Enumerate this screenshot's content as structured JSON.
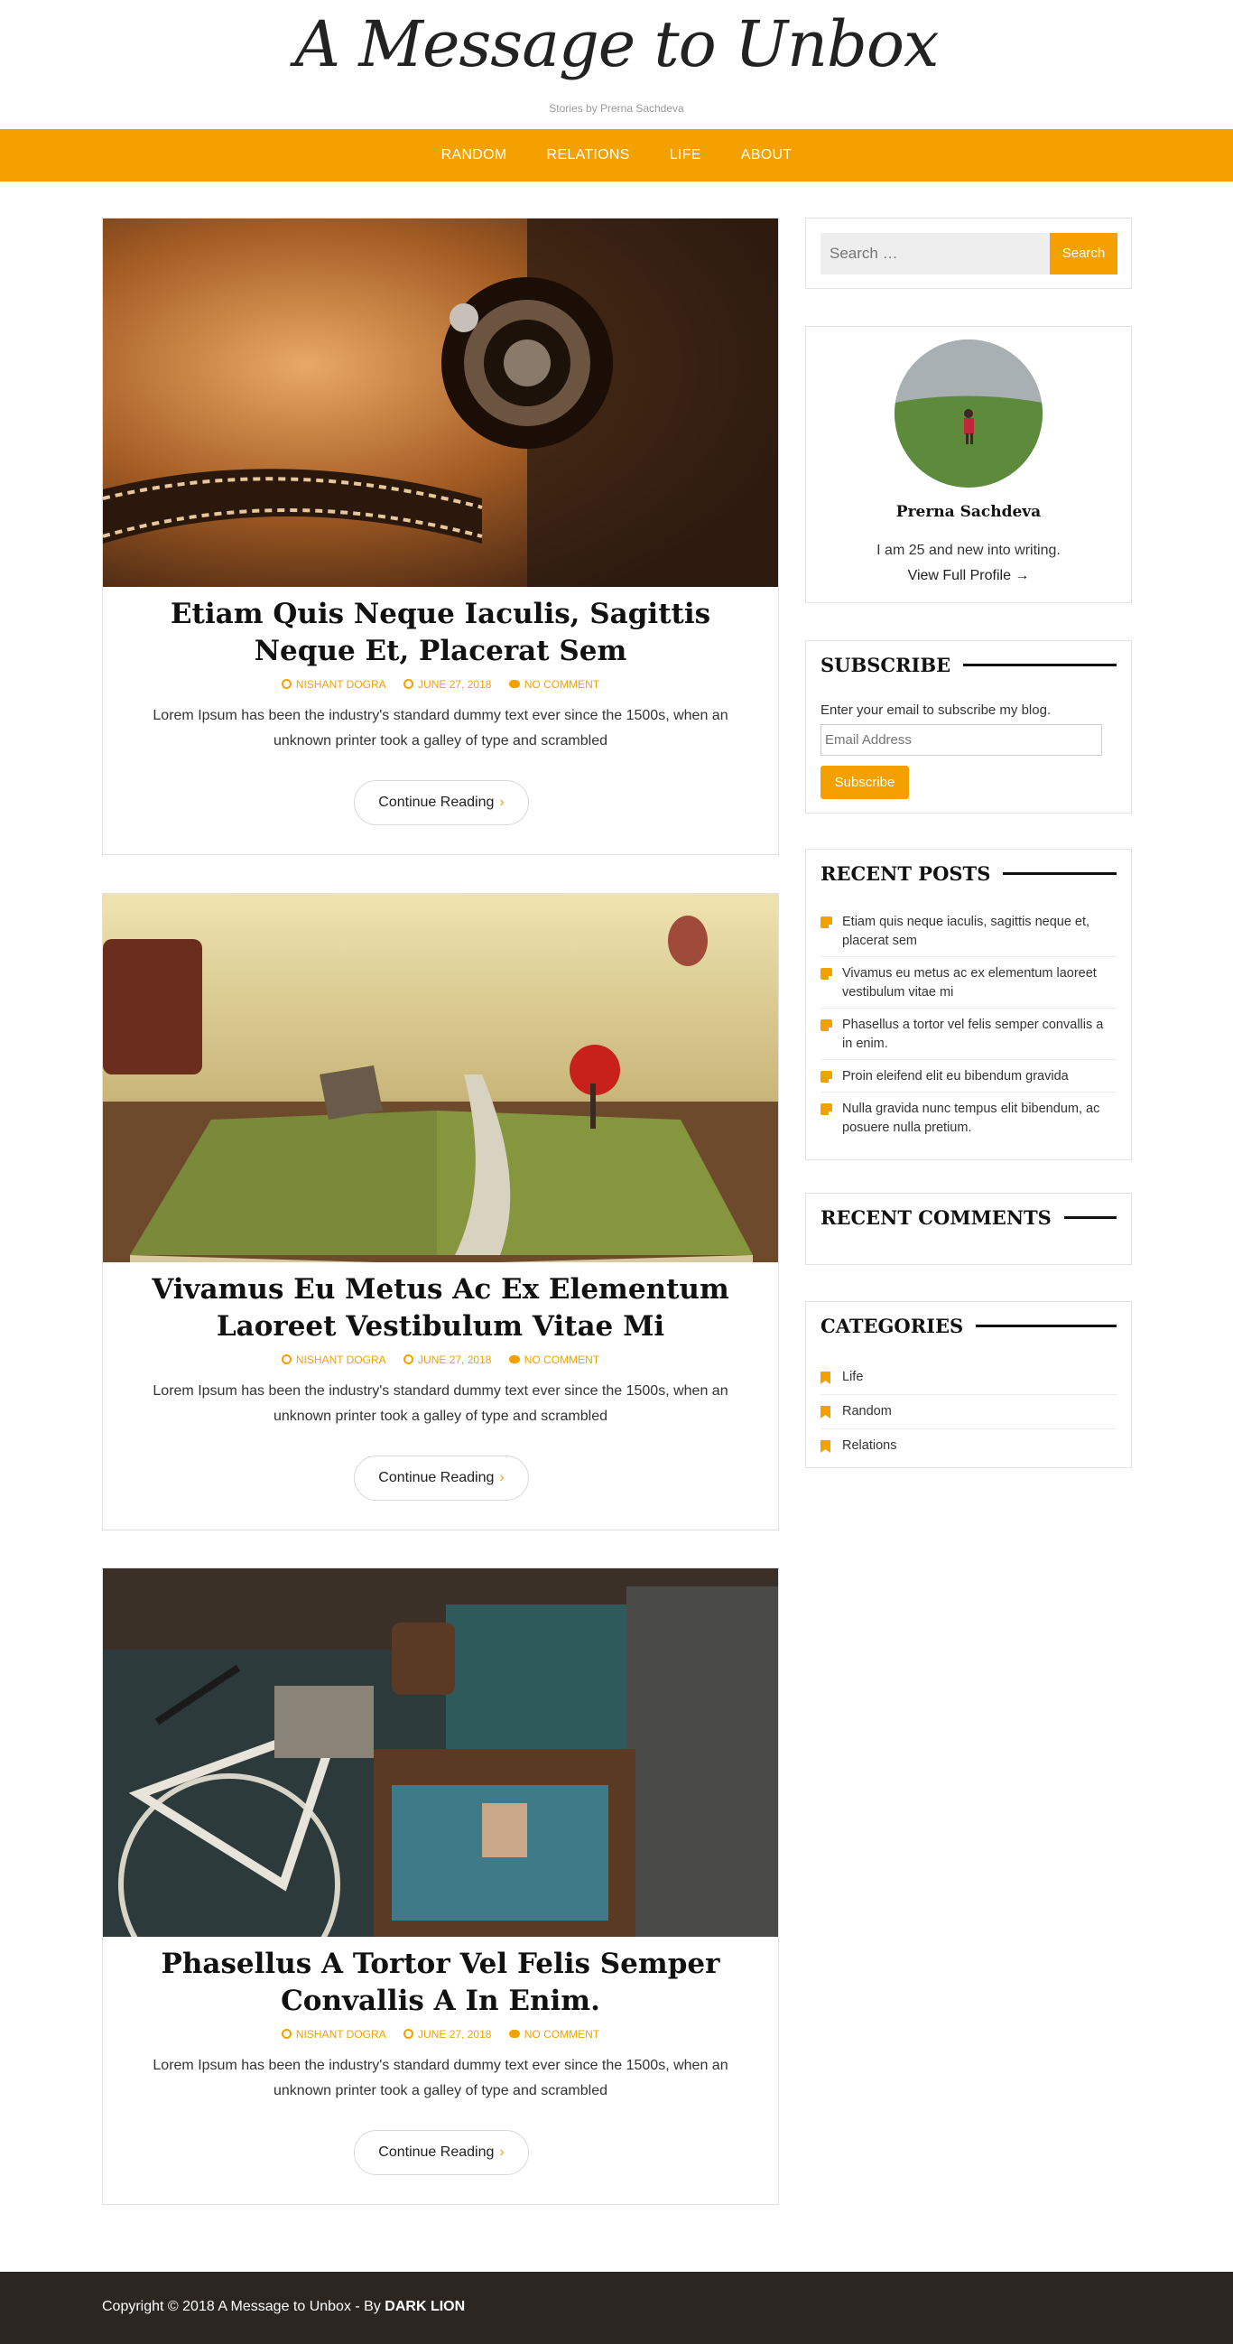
{
  "site": {
    "title": "A Message to Unbox",
    "description": "Stories by Prerna Sachdeva"
  },
  "nav": {
    "items": [
      {
        "label": "RANDOM"
      },
      {
        "label": "RELATIONS"
      },
      {
        "label": "LIFE"
      },
      {
        "label": "ABOUT"
      }
    ]
  },
  "posts": [
    {
      "title": "Etiam Quis Neque Iaculis, Sagittis Neque Et, Placerat Sem",
      "author": "NISHANT DOGRA",
      "date": "JUNE 27, 2018",
      "comments": "NO COMMENT",
      "excerpt": "Lorem Ipsum has been the industry's standard dummy text ever since the 1500s, when an unknown printer took a galley of type and scrambled",
      "more": "Continue Reading"
    },
    {
      "title": "Vivamus Eu Metus Ac Ex Elementum Laoreet Vestibulum Vitae Mi",
      "author": "NISHANT DOGRA",
      "date": "JUNE 27, 2018",
      "comments": "NO COMMENT",
      "excerpt": "Lorem Ipsum has been the industry's standard dummy text ever since the 1500s, when an unknown printer took a galley of type and scrambled",
      "more": "Continue Reading"
    },
    {
      "title": "Phasellus A Tortor Vel Felis Semper Convallis A In Enim.",
      "author": "NISHANT DOGRA",
      "date": "JUNE 27, 2018",
      "comments": "NO COMMENT",
      "excerpt": "Lorem Ipsum has been the industry's standard dummy text ever since the 1500s, when an unknown printer took a galley of type and scrambled",
      "more": "Continue Reading"
    }
  ],
  "sidebar": {
    "search": {
      "placeholder": "Search …",
      "button": "Search"
    },
    "profile": {
      "name": "Prerna Sachdeva",
      "bio": "I am 25 and new into writing.",
      "link": "View Full Profile →"
    },
    "subscribe": {
      "title": "SUBSCRIBE",
      "text": "Enter your email to subscribe my blog.",
      "placeholder": "Email Address",
      "button": "Subscribe"
    },
    "recent_posts": {
      "title": "RECENT POSTS",
      "items": [
        "Etiam quis neque iaculis, sagittis neque et, placerat sem",
        "Vivamus eu metus ac ex elementum laoreet vestibulum vitae mi",
        "Phasellus a tortor vel felis semper convallis a in enim.",
        "Proin eleifend elit eu bibendum gravida",
        "Nulla gravida nunc tempus elit bibendum, ac posuere nulla pretium."
      ]
    },
    "recent_comments": {
      "title": "RECENT COMMENTS"
    },
    "categories": {
      "title": "CATEGORIES",
      "items": [
        "Life",
        "Random",
        "Relations"
      ]
    }
  },
  "footer": {
    "copyright": "Copyright © 2018 A Message to Unbox - By ",
    "credit": "DARK LION"
  },
  "colors": {
    "accent": "#f4a100",
    "footer_bg": "#2b2622"
  }
}
